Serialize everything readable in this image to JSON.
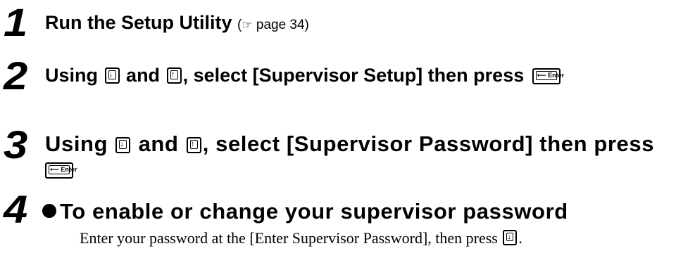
{
  "steps": [
    {
      "number": "1",
      "title": "Run the Setup Utility",
      "ref_open": "(",
      "ref_icon": "☞",
      "ref_text": "page 34)"
    },
    {
      "number": "2",
      "prefix": "Using",
      "and": "and",
      "suffix": ", select [Supervisor Setup] then press"
    },
    {
      "number": "3",
      "prefix": "Using",
      "and": "and",
      "suffix": ", select [Supervisor Password] then press"
    },
    {
      "number": "4",
      "title": "To enable or change your supervisor password",
      "body_text": "Enter your password at the [Enter Supervisor Password], then press",
      "body_end": "."
    }
  ],
  "keys": {
    "down_arrow": "↓",
    "up_arrow": "↑",
    "enter_label": "⟵ Enter"
  },
  "icons": {
    "reference": "pointing-hand-icon",
    "bullet": "bullet-icon"
  }
}
